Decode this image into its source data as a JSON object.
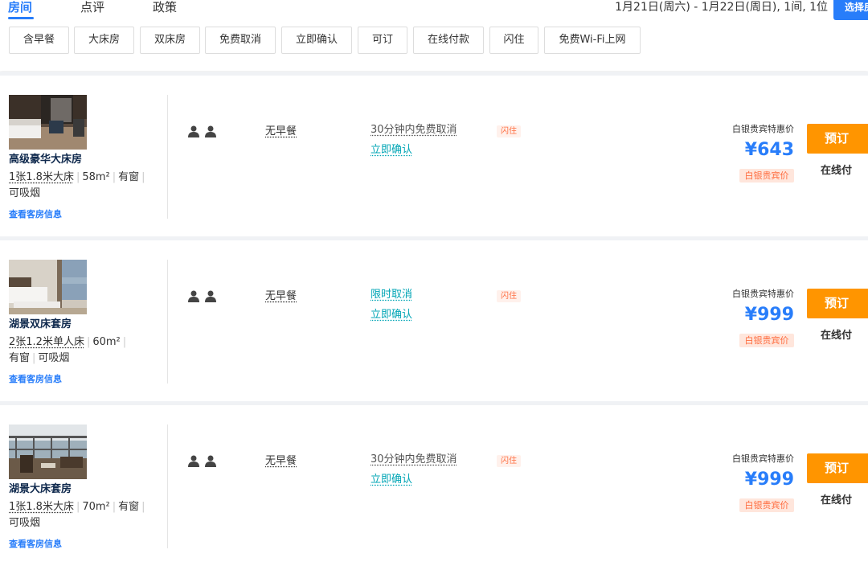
{
  "tabs": [
    {
      "label": "房间",
      "active": true
    },
    {
      "label": "点评",
      "active": false
    },
    {
      "label": "政策",
      "active": false
    }
  ],
  "stay_info": "1月21日(周六) - 1月22日(周日), 1间, 1位",
  "select_button": "选择房",
  "filters": [
    "含早餐",
    "大床房",
    "双床房",
    "免费取消",
    "立即确认",
    "可订",
    "在线付款",
    "闪住",
    "免费Wi-Fi上网"
  ],
  "colors": {
    "accent": "#287dfa",
    "book": "#ff9500",
    "cancel_teal": "#00a5b5",
    "badge_orange": "#ff6f42"
  },
  "rooms": [
    {
      "name": "高级豪华大床房",
      "bed": "1张1.8米大床",
      "area": "58m²",
      "window": "有窗",
      "smoking": "可吸烟",
      "link": "查看客房信息",
      "guests": 2,
      "breakfast": "无早餐",
      "cancel": "30分钟内免费取消",
      "cancel_color": "#555555",
      "confirm": "立即确认",
      "badge": "闪住",
      "price_label": "白银贵宾特惠价",
      "price": "¥643",
      "price_tag": "白银贵宾价",
      "book": "预订",
      "pay": "在线付"
    },
    {
      "name": "湖景双床套房",
      "bed": "2张1.2米单人床",
      "area": "60m²",
      "window": "有窗",
      "smoking": "可吸烟",
      "link": "查看客房信息",
      "guests": 2,
      "breakfast": "无早餐",
      "cancel": "限时取消",
      "cancel_color": "#00a5b5",
      "confirm": "立即确认",
      "badge": "闪住",
      "price_label": "白银贵宾特惠价",
      "price": "¥999",
      "price_tag": "白银贵宾价",
      "book": "预订",
      "pay": "在线付"
    },
    {
      "name": "湖景大床套房",
      "bed": "1张1.8米大床",
      "area": "70m²",
      "window": "有窗",
      "smoking": "可吸烟",
      "link": "查看客房信息",
      "guests": 2,
      "breakfast": "无早餐",
      "cancel": "30分钟内免费取消",
      "cancel_color": "#555555",
      "confirm": "立即确认",
      "badge": "闪住",
      "price_label": "白银贵宾特惠价",
      "price": "¥999",
      "price_tag": "白银贵宾价",
      "book": "预订",
      "pay": "在线付"
    }
  ]
}
